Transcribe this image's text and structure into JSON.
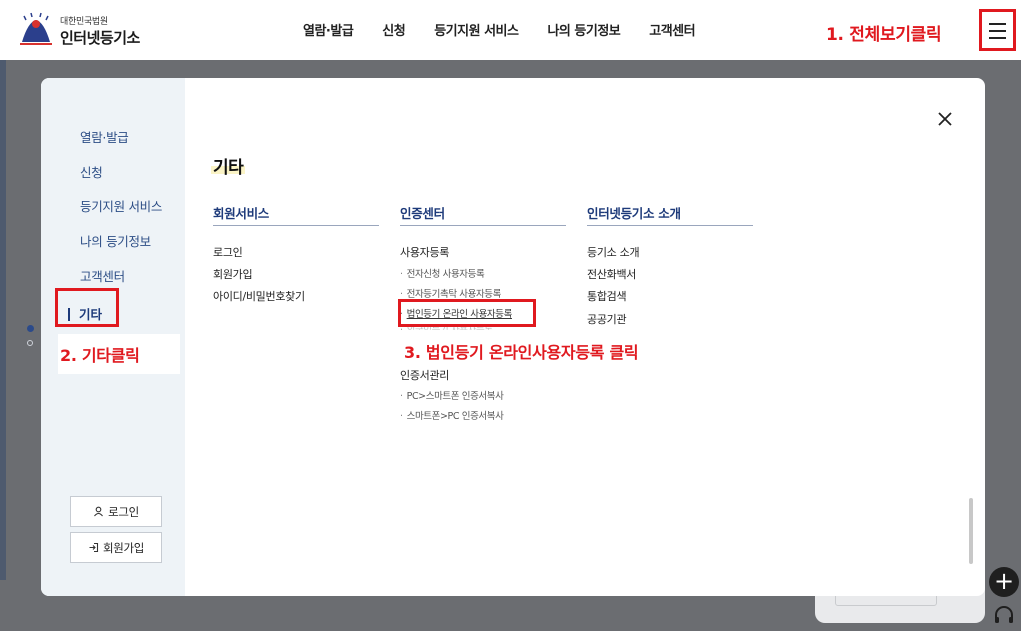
{
  "header": {
    "logo_small": "대한민국법원",
    "logo_big": "인터넷등기소",
    "nav": [
      "열람·발급",
      "신청",
      "등기지원 서비스",
      "나의 등기정보",
      "고객센터"
    ]
  },
  "annotations": {
    "step1": "1. 전체보기클릭",
    "step2": "2. 기타클릭",
    "step3": "3. 법인등기 온라인사용자등록 클릭",
    "color": "#e0191f"
  },
  "sidebar": {
    "items": [
      "열람·발급",
      "신청",
      "등기지원 서비스",
      "나의 등기정보",
      "고객센터"
    ],
    "active": "기타",
    "login_label": "로그인",
    "signup_label": "회원가입"
  },
  "content": {
    "title": "기타",
    "columns": [
      {
        "title": "회원서비스",
        "links": [
          "로그인",
          "회원가입",
          "아이디/비밀번호찾기"
        ]
      },
      {
        "title": "인증센터",
        "group1": "사용자등록",
        "group1_sub": [
          "전자신청 사용자등록",
          "전자등기촉탁 사용자등록",
          "법인등기 온라인 사용자등록",
          "외국인등기 사용자등록"
        ],
        "group2": "인증서관리",
        "group2_sub": [
          "PC>스마트폰 인증서복사",
          "스마트폰>PC 인증서복사"
        ]
      },
      {
        "title": "인터넷등기소 소개",
        "links": [
          "등기소 소개",
          "전산화백서",
          "통합검색",
          "공공기관"
        ]
      }
    ]
  },
  "colors": {
    "accent": "#1d3a7a",
    "sidebar_bg": "#eef3f7",
    "dim": "#6b6d71",
    "highlight": "#fbf4c6"
  },
  "icons": [
    "hamburger-icon",
    "close-icon",
    "user-icon",
    "login-arrow-icon",
    "plus-icon",
    "headset-icon"
  ]
}
